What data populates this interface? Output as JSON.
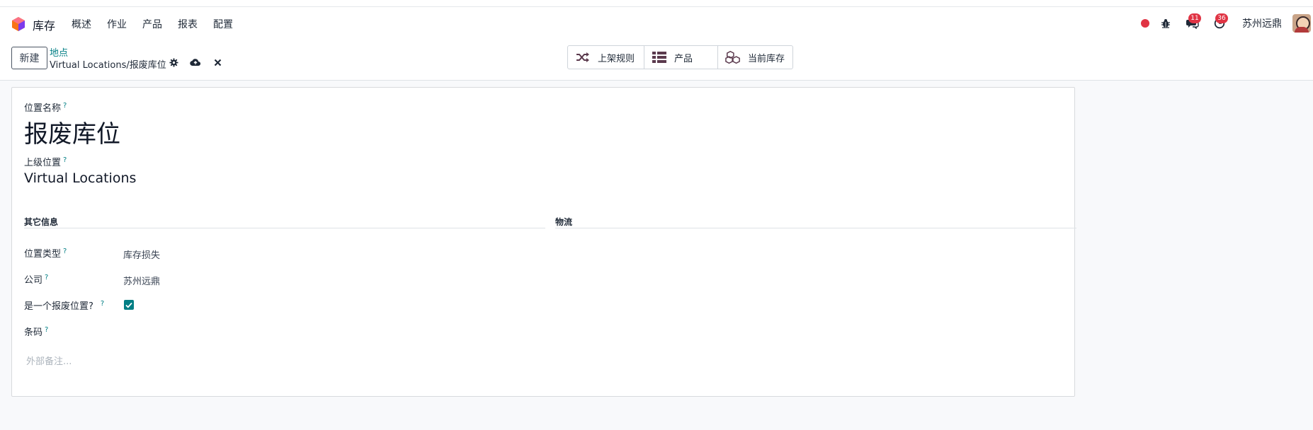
{
  "navbar": {
    "app_name": "库存",
    "menu": [
      "概述",
      "作业",
      "产品",
      "报表",
      "配置"
    ],
    "messages_count": "11",
    "activities_count": "36",
    "company": "苏州远鼎"
  },
  "control_panel": {
    "new_label": "新建",
    "breadcrumb_parent": "地点",
    "breadcrumb_current": "Virtual Locations/报废库位",
    "smart_buttons": [
      {
        "label": "上架规则",
        "icon": "shuffle-icon"
      },
      {
        "label": "产品",
        "icon": "list-icon"
      },
      {
        "label": "当前库存",
        "icon": "cubes-icon"
      }
    ]
  },
  "form": {
    "name_label": "位置名称",
    "name_value": "报废库位",
    "parent_label": "上级位置",
    "parent_value": "Virtual Locations",
    "help_mark": "?",
    "group_other": "其它信息",
    "group_logistics": "物流",
    "type_label": "位置类型",
    "type_value": "库存损失",
    "company_label": "公司",
    "company_value": "苏州远鼎",
    "scrap_label": "是一个报废位置?",
    "scrap_checked": true,
    "barcode_label": "条码",
    "barcode_value": "",
    "notes_placeholder": "外部备注..."
  },
  "colors": {
    "accent": "#017e84",
    "badge": "#e03444",
    "brand_icon": "#5b3a4d"
  }
}
